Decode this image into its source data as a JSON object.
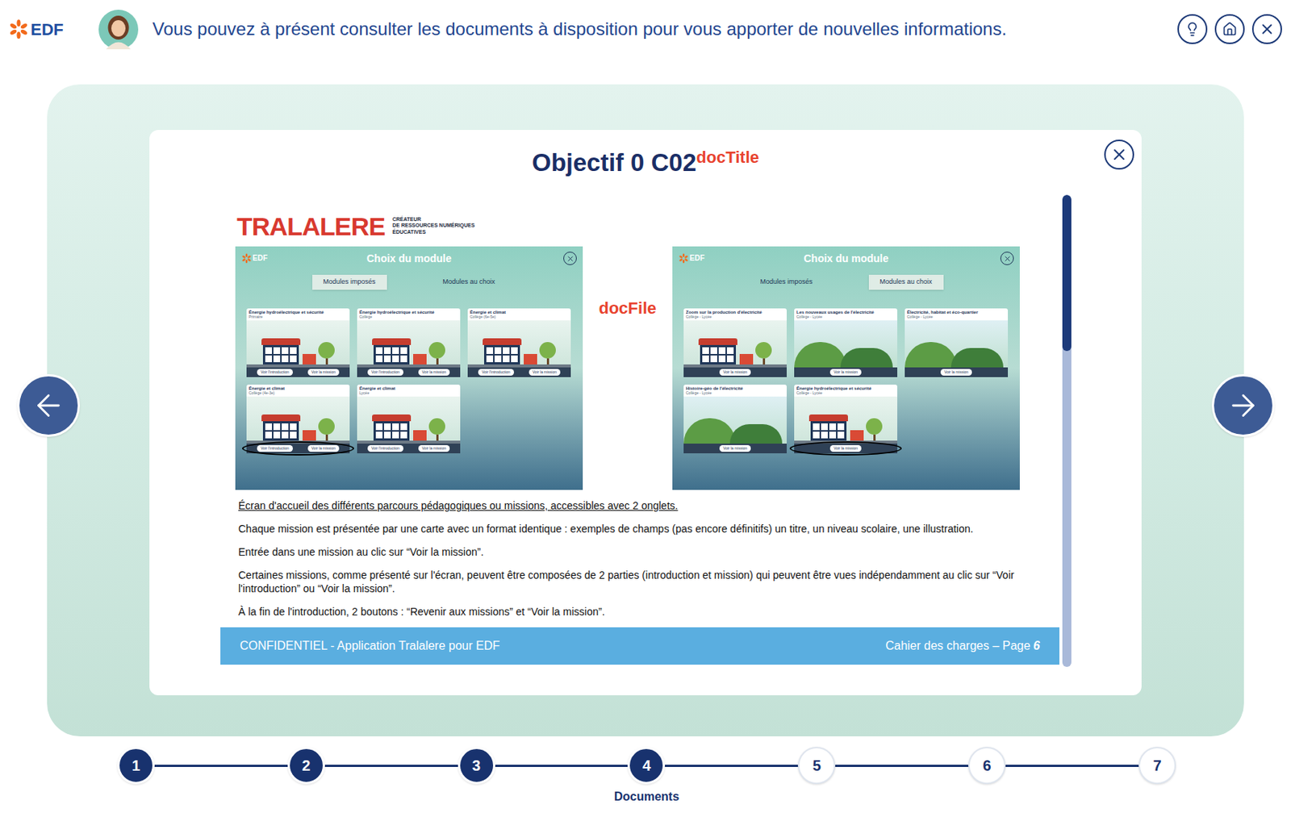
{
  "header": {
    "logo": "EDF",
    "message": "Vous pouvez à présent consulter les documents à disposition pour vous apporter de nouvelles informations."
  },
  "modal": {
    "title": "Objectif 0 C02",
    "titleAnnotation": "docTitle",
    "fileAnnotation": "docFile"
  },
  "document": {
    "publisher": {
      "name": "TRALALERE",
      "tagline": [
        "CRÉATEUR",
        "DE RESSOURCES NUMÉRIQUES",
        "ÉDUCATIVES"
      ]
    },
    "screens": [
      {
        "logo": "EDF",
        "title": "Choix du module",
        "tabs": [
          {
            "label": "Modules imposés",
            "selected": true
          },
          {
            "label": "Modules au choix",
            "selected": false
          }
        ],
        "cards": [
          {
            "title": "Énergie hydroélectrique et sécurité",
            "level": "Primaire",
            "kind": "school",
            "circled": false,
            "buttons": [
              "Voir l'introduction",
              "Voir la mission"
            ]
          },
          {
            "title": "Énergie hydroélectrique et sécurité",
            "level": "Collège",
            "kind": "school",
            "circled": false,
            "buttons": [
              "Voir l'introduction",
              "Voir la mission"
            ]
          },
          {
            "title": "Énergie et climat",
            "level": "Collège (6e-5e)",
            "kind": "school",
            "circled": false,
            "buttons": [
              "Voir l'introduction",
              "Voir la mission"
            ]
          },
          {
            "title": "Énergie et climat",
            "level": "Collège (4e-3e)",
            "kind": "school",
            "circled": true,
            "buttons": [
              "Voir l'introduction",
              "Voir la mission"
            ]
          },
          {
            "title": "Énergie et climat",
            "level": "Lycée",
            "kind": "school",
            "circled": false,
            "buttons": [
              "Voir l'introduction",
              "Voir la mission"
            ]
          }
        ]
      },
      {
        "logo": "EDF",
        "title": "Choix du module",
        "tabs": [
          {
            "label": "Modules imposés",
            "selected": false
          },
          {
            "label": "Modules au choix",
            "selected": true
          }
        ],
        "cards": [
          {
            "title": "Zoom sur la production d'électricité",
            "level": "Collège - Lycée",
            "kind": "school",
            "circled": false,
            "buttons": [
              "Voir la mission"
            ]
          },
          {
            "title": "Les nouveaux usages de l'électricité",
            "level": "Collège - Lycée",
            "kind": "landscape",
            "circled": false,
            "buttons": [
              "Voir la mission"
            ]
          },
          {
            "title": "Électricité, habitat et éco-quartier",
            "level": "Collège - Lycée",
            "kind": "landscape",
            "circled": false,
            "buttons": [
              "Voir la mission"
            ]
          },
          {
            "title": "Histoire-géo de l'électricité",
            "level": "Collège - Lycée",
            "kind": "landscape",
            "circled": false,
            "buttons": [
              "Voir la mission"
            ]
          },
          {
            "title": "Énergie hydroélectrique et sécurité",
            "level": "Collège - Lycée",
            "kind": "school",
            "circled": true,
            "buttons": [
              "Voir la mission"
            ]
          }
        ]
      }
    ],
    "caption": "Écran d'accueil des différents parcours pédagogiques ou missions, accessibles avec 2 onglets.",
    "paragraphs": [
      "Chaque mission est présentée par une carte avec un format identique : exemples de champs (pas encore définitifs) un titre, un niveau scolaire, une illustration.",
      "Entrée dans une mission au clic sur “Voir la mission”.",
      "Certaines missions, comme présenté sur l'écran, peuvent être composées de 2 parties (introduction et mission) qui peuvent être vues indépendamment au clic sur “Voir l'introduction” ou “Voir la mission”.",
      "À la fin de l'introduction, 2 boutons : “Revenir aux missions” et “Voir la mission”."
    ],
    "footer": {
      "left": "CONFIDENTIEL - Application Tralalere pour EDF",
      "right": "Cahier des charges – Page",
      "page": "6"
    }
  },
  "scrollbar": {
    "level": 0.33
  },
  "stepper": {
    "steps": [
      {
        "number": "1",
        "done": true,
        "selected": false
      },
      {
        "number": "2",
        "done": true,
        "selected": false
      },
      {
        "number": "3",
        "done": true,
        "selected": false
      },
      {
        "number": "4",
        "done": true,
        "selected": true,
        "label": "Documents"
      },
      {
        "number": "5",
        "done": false,
        "selected": false
      },
      {
        "number": "6",
        "done": false,
        "selected": false
      },
      {
        "number": "7",
        "done": false,
        "selected": false
      }
    ]
  }
}
